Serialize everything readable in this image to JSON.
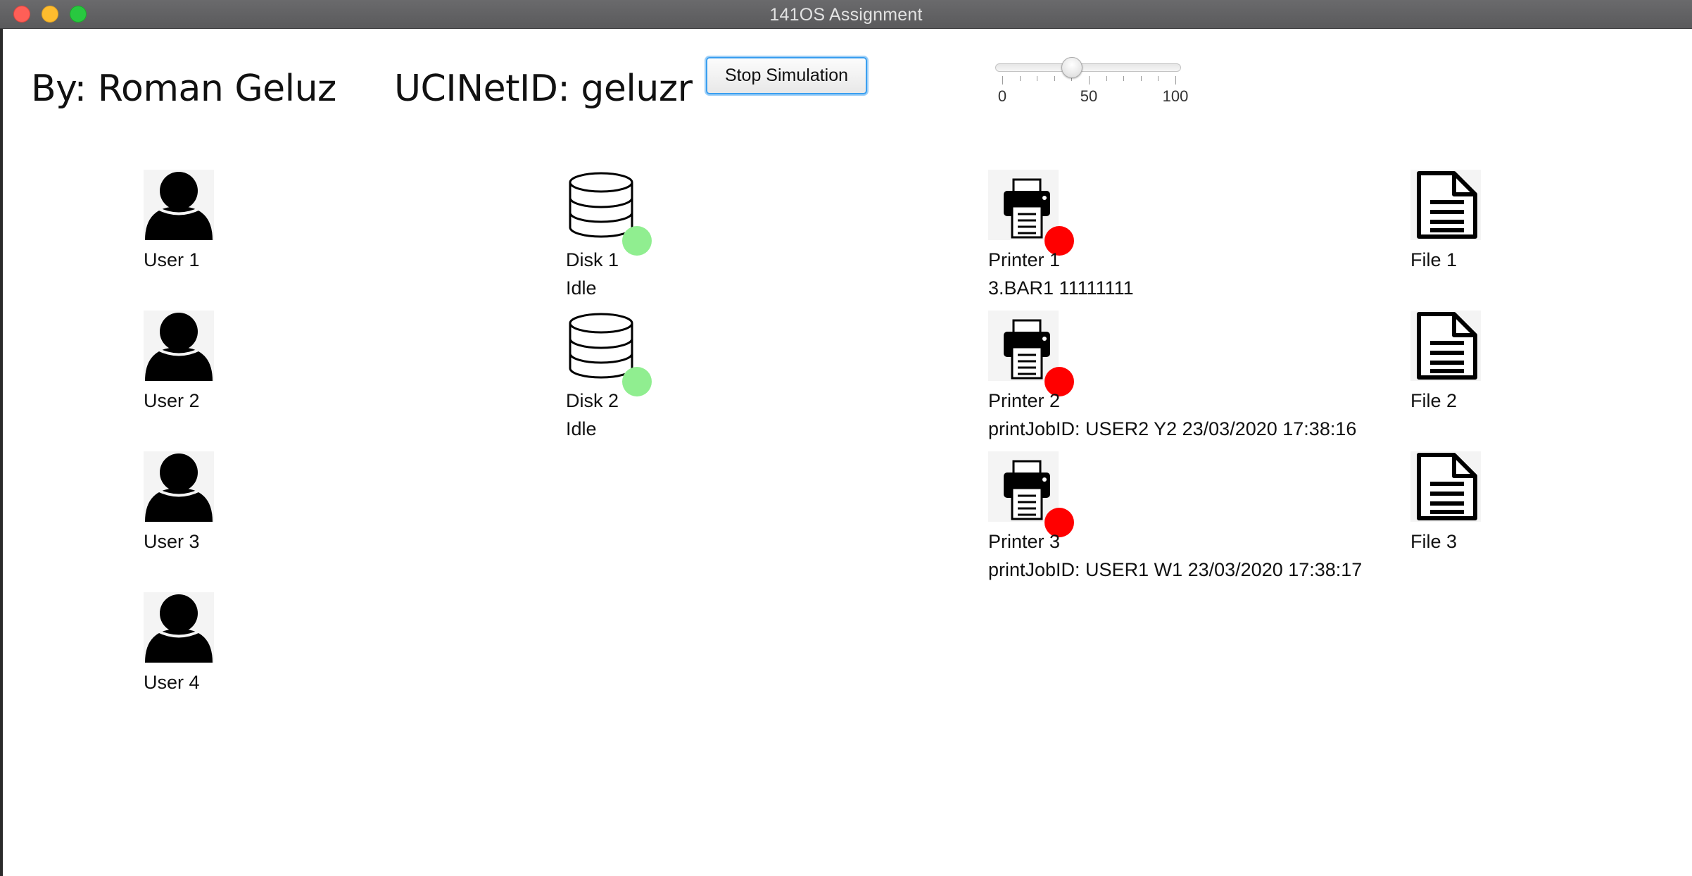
{
  "window": {
    "title": "141OS Assignment",
    "traffic_lights": [
      "close",
      "minimize",
      "zoom"
    ]
  },
  "header": {
    "author": "By: Roman Geluz",
    "netid": "UCINetID: geluzr",
    "stop_button": "Stop Simulation",
    "slider": {
      "value": 40,
      "min": 0,
      "max": 100,
      "tick_labels": [
        "0",
        "50",
        "100"
      ]
    }
  },
  "users": [
    {
      "label": "User 1",
      "icon": "user-icon"
    },
    {
      "label": "User 2",
      "icon": "user-icon"
    },
    {
      "label": "User 3",
      "icon": "user-icon"
    },
    {
      "label": "User 4",
      "icon": "user-icon"
    }
  ],
  "disks": [
    {
      "label": "Disk 1",
      "status": "Idle",
      "icon": "database-icon",
      "indicator_color": "#90ee90"
    },
    {
      "label": "Disk 2",
      "status": "Idle",
      "icon": "database-icon",
      "indicator_color": "#90ee90"
    }
  ],
  "printers": [
    {
      "label": "Printer 1",
      "status": "3.BAR1 11111111",
      "icon": "printer-icon",
      "indicator_color": "#ff0000"
    },
    {
      "label": "Printer 2",
      "status": "printJobID: USER2 Y2 23/03/2020 17:38:16",
      "icon": "printer-icon",
      "indicator_color": "#ff0000"
    },
    {
      "label": "Printer 3",
      "status": "printJobID: USER1 W1 23/03/2020 17:38:17",
      "icon": "printer-icon",
      "indicator_color": "#ff0000"
    }
  ],
  "files": [
    {
      "label": "File 1",
      "icon": "file-icon"
    },
    {
      "label": "File 2",
      "icon": "file-icon"
    },
    {
      "label": "File 3",
      "icon": "file-icon"
    }
  ]
}
